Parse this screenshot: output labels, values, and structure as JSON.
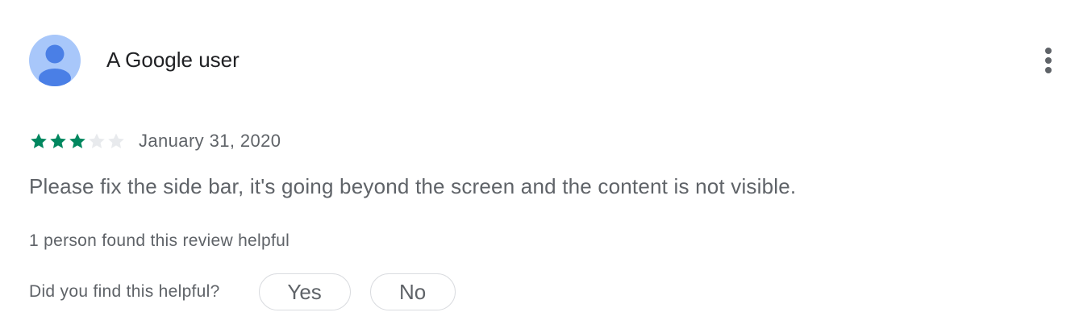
{
  "review": {
    "author": "A Google user",
    "avatar_icon": "person-icon",
    "menu_icon": "more-vert-icon",
    "rating": 3,
    "rating_max": 5,
    "star_filled_color": "#01875f",
    "star_empty_color": "#e8eaed",
    "date": "January 31, 2020",
    "text": "Please fix the side bar, it's going beyond the screen and the content is not visible.",
    "helpful_count_text": "1 person found this review helpful",
    "helpful_question": "Did you find this helpful?",
    "yes_label": "Yes",
    "no_label": "No"
  }
}
